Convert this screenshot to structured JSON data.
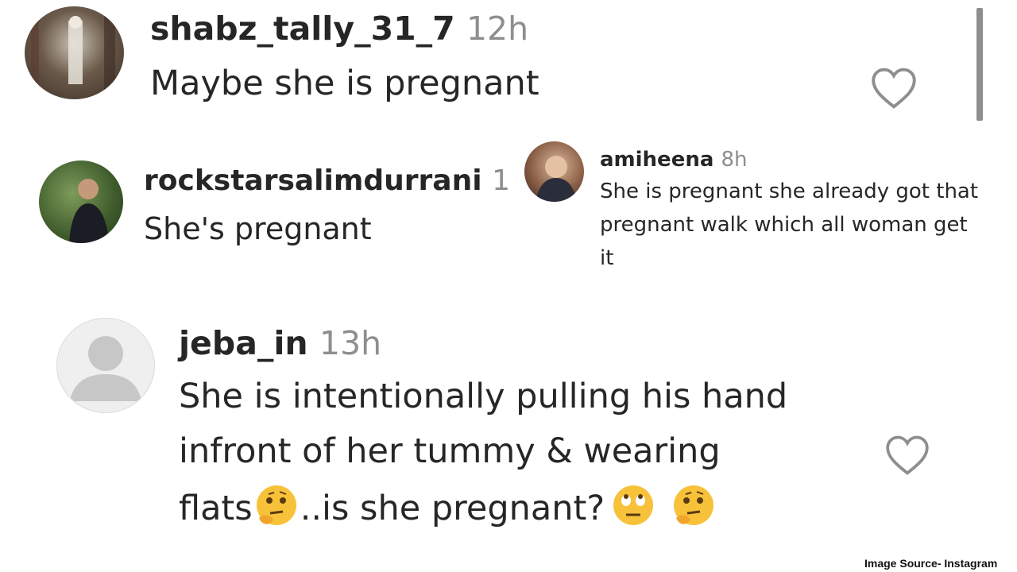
{
  "comments": [
    {
      "username": "shabz_tally_31_7",
      "time": "12h",
      "text": "Maybe she is pregnant",
      "avatar_icon": "profile-photo",
      "has_like": true
    },
    {
      "username": "rockstarsalimdurrani",
      "time": "1",
      "text": "She's pregnant",
      "avatar_icon": "profile-photo",
      "has_like": false
    },
    {
      "username": "amiheena",
      "time": "8h",
      "lines": [
        "She is pregnant she already got that",
        "pregnant walk which all woman get",
        "it"
      ],
      "avatar_icon": "profile-photo",
      "has_like": false
    },
    {
      "username": "jeba_in",
      "time": "13h",
      "lines": [
        "She is intentionally pulling his hand",
        "infront of her tummy & wearing",
        "flats",
        "..is she pregnant?"
      ],
      "avatar_icon": "default-avatar-icon",
      "has_like": true
    }
  ],
  "footer": {
    "credit": "Image Source- Instagram"
  },
  "icons": {
    "like": "heart-outline-icon",
    "thinking_emoji": "thinking-face-emoji",
    "eye_roll_emoji": "face-with-rolling-eyes-emoji"
  },
  "colors": {
    "text": "#262626",
    "timestamp": "#8e8e8e",
    "icon": "#8e8e8e"
  }
}
